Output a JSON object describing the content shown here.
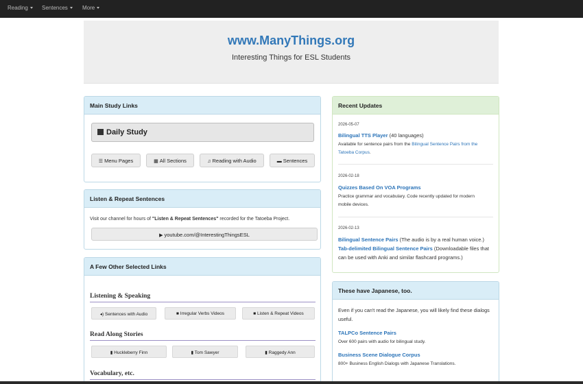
{
  "nav": {
    "items": [
      "Reading",
      "Sentences",
      "More"
    ]
  },
  "header": {
    "title": "www.ManyThings.org",
    "subtitle": "Interesting Things for ESL Students"
  },
  "main_study": {
    "title": "Main Study Links",
    "daily_study": "Daily Study",
    "buttons": [
      "Menu Pages",
      "All Sections",
      "Reading with Audio",
      "Sentences"
    ]
  },
  "listen_repeat": {
    "title": "Listen & Repeat Sentences",
    "text_before": "Visit our channel for hours of ",
    "text_bold": "\"Listen & Repeat Sentences\"",
    "text_after": " recorded for the Tatoeba Project.",
    "youtube": "youtube.com/@InterestingThingsESL"
  },
  "other_links": {
    "title": "A Few Other Selected Links",
    "sections": [
      {
        "heading": "Listening & Speaking",
        "buttons": [
          "Sentences with Audio",
          "Irregular Verbs Videos",
          "Listen & Repeat Videos"
        ]
      },
      {
        "heading": "Read Along Stories",
        "buttons": [
          "Huckleberry Finn",
          "Tom Sawyer",
          "Raggedy Ann"
        ]
      },
      {
        "heading": "Vocabulary, etc."
      }
    ]
  },
  "updates": {
    "title": "Recent Updates",
    "entries": [
      {
        "date": "2026-05-07",
        "link": "Bilingual TTS Player",
        "link_suffix": " (40 languages)",
        "note_before": "Available for sentence pairs from the ",
        "note_link": "Bilingual Sentence Pairs from the",
        "note_link2": "Tatoeba Corpus",
        "note_after": "."
      },
      {
        "date": "2026-02-18",
        "link": "Quizzes Based On VOA Programs",
        "note1": "Practice grammar and vocabulary. Code recently updated for modern",
        "note2": "mobile devices."
      },
      {
        "date": "2026-02-13",
        "link": "Bilingual Sentence Pairs",
        "link_suffix": " (The audio is by a real human voice.)",
        "link2": "Tab-delimited Bilingual Sentence Pairs",
        "link2_suffix": " (Downloadable files that",
        "line3": "can be used with Anki and similar flashcard programs.)"
      }
    ]
  },
  "japanese": {
    "title": "These have Japanese, too.",
    "intro1": "Even if you can't read the Japanese, you will likely find these dialogs",
    "intro2": "useful.",
    "link1": "TALPCo Sentence Pairs",
    "desc1": "Over 600 pairs with audio for bilingual study.",
    "link2": "Business Scene Dialogue Corpus",
    "desc2": "800+ Business English Dialogs with Japanese Translations."
  }
}
